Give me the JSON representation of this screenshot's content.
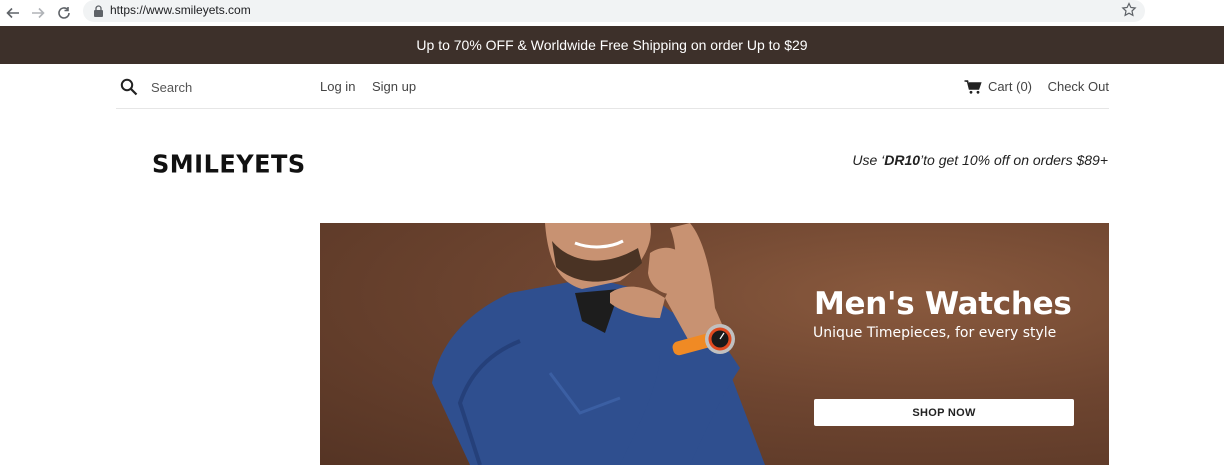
{
  "browser": {
    "url": "https://www.smileyets.com"
  },
  "promo": {
    "text": "Up to 70% OFF & Worldwide Free Shipping on order Up to $29"
  },
  "header": {
    "search_placeholder": "Search",
    "login_label": "Log in",
    "signup_label": "Sign up",
    "cart_label": "Cart (0)",
    "checkout_label": "Check Out"
  },
  "brand": {
    "logo_text": "SMILEYETS",
    "coupon_prefix": "Use ‘",
    "coupon_code": "DR10",
    "coupon_suffix": "’to get 10% off on orders  $89+"
  },
  "hero": {
    "title": "Men's Watches",
    "subtitle": "Unique Timepieces, for every style",
    "button_label": "SHOP NOW"
  },
  "colors": {
    "promo_bg": "#3d302a",
    "hero_bg": "#6e4530",
    "watch_strap": "#f08a24",
    "shirt": "#2f4f8f"
  }
}
